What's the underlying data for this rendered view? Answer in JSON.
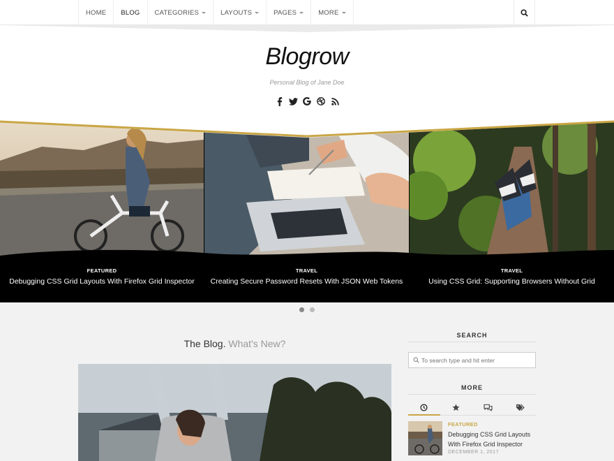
{
  "nav": {
    "items": [
      {
        "label": "HOME",
        "dropdown": false
      },
      {
        "label": "BLOG",
        "dropdown": false
      },
      {
        "label": "CATEGORIES",
        "dropdown": true
      },
      {
        "label": "LAYOUTS",
        "dropdown": true
      },
      {
        "label": "PAGES",
        "dropdown": true
      },
      {
        "label": "MORE",
        "dropdown": true
      }
    ],
    "active": "BLOG",
    "search_icon": "search-icon"
  },
  "header": {
    "logo_part1": "Blog",
    "logo_part2": "row",
    "tagline": "Personal Blog of Jane Doe",
    "social_icons": [
      "facebook-icon",
      "twitter-icon",
      "google-icon",
      "dribbble-icon",
      "rss-icon"
    ]
  },
  "slider": {
    "slides": [
      {
        "category": "FEATURED",
        "title": "Debugging CSS Grid Layouts With Firefox Grid Inspector"
      },
      {
        "category": "TRAVEL",
        "title": "Creating Secure Password Resets With JSON Web Tokens"
      },
      {
        "category": "TRAVEL",
        "title": "Using CSS Grid: Supporting Browsers Without Grid"
      }
    ],
    "dots": 2,
    "active_dot": 0
  },
  "main": {
    "heading": "The Blog.",
    "heading_sub": "What's New?"
  },
  "sidebar": {
    "search_title": "SEARCH",
    "search_placeholder": "To search type and hit enter",
    "more_title": "MORE",
    "tabs": [
      "clock-icon",
      "star-icon",
      "comments-icon",
      "tags-icon"
    ],
    "active_tab": 0,
    "post": {
      "category": "FEATURED",
      "title": "Debugging CSS Grid Layouts With Firefox Grid Inspector",
      "date": "DECEMBER 1, 2017"
    }
  },
  "colors": {
    "accent": "#c9a646",
    "slider_bg": "#000000",
    "page_bg": "#f2f2f2"
  }
}
